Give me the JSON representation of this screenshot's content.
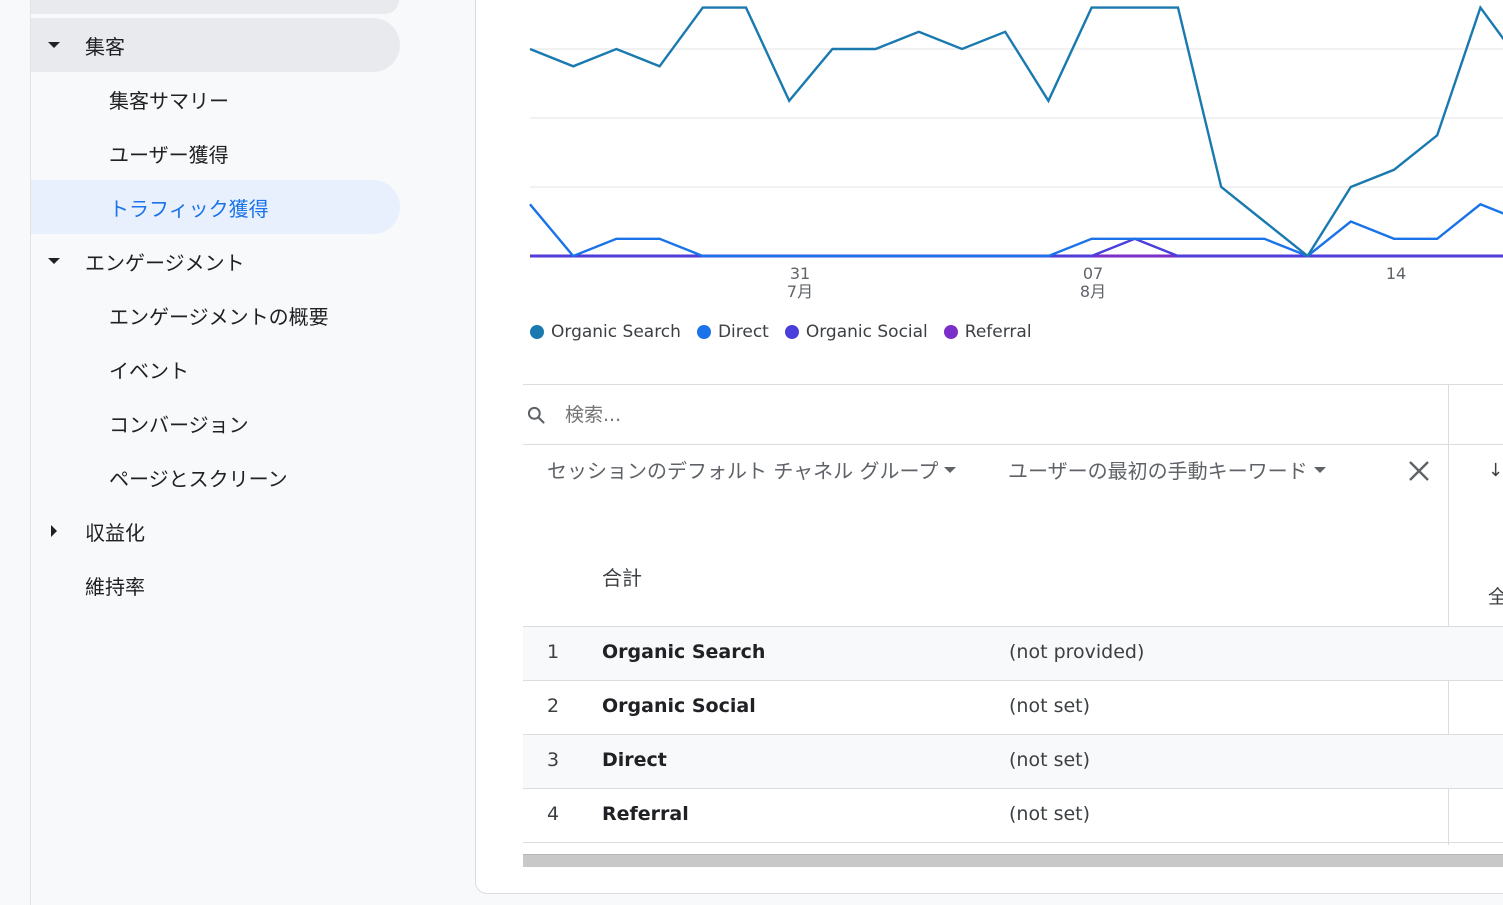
{
  "sidebar": {
    "items": [
      {
        "label": "集客",
        "level": 1,
        "caret": "down",
        "state": "active-group"
      },
      {
        "label": "集客サマリー",
        "level": 2
      },
      {
        "label": "ユーザー獲得",
        "level": 2
      },
      {
        "label": "トラフィック獲得",
        "level": 2,
        "state": "selected"
      },
      {
        "label": "エンゲージメント",
        "level": 1,
        "caret": "down"
      },
      {
        "label": "エンゲージメントの概要",
        "level": 2
      },
      {
        "label": "イベント",
        "level": 2
      },
      {
        "label": "コンバージョン",
        "level": 2
      },
      {
        "label": "ページとスクリーン",
        "level": 2
      },
      {
        "label": "収益化",
        "level": 1,
        "caret": "right"
      },
      {
        "label": "維持率",
        "level": 1
      }
    ]
  },
  "chart_data": {
    "type": "line",
    "x_ticks": [
      {
        "day": "31",
        "month": "7月"
      },
      {
        "day": "07",
        "month": "8月"
      },
      {
        "day": "14",
        "month": ""
      }
    ],
    "series": [
      {
        "name": "Organic Search",
        "color": "#1a7ab0",
        "values": [
          6,
          5.5,
          6,
          5.5,
          7.2,
          7.2,
          4.5,
          6,
          6,
          6.5,
          6,
          6.5,
          4.5,
          7.2,
          7.2,
          7.2,
          2,
          1,
          0,
          2,
          2.5,
          3.5,
          7.2,
          5.5,
          7.2
        ]
      },
      {
        "name": "Direct",
        "color": "#1a73e8",
        "values": [
          1.5,
          0,
          0.5,
          0.5,
          0,
          0,
          0,
          0,
          0,
          0,
          0,
          0,
          0,
          0.5,
          0.5,
          0.5,
          0.5,
          0.5,
          0,
          1,
          0.5,
          0.5,
          1.5,
          1,
          1
        ]
      },
      {
        "name": "Organic Social",
        "color": "#4a3fdb",
        "values": [
          0,
          0,
          0,
          0,
          0,
          0,
          0,
          0,
          0,
          0,
          0,
          0,
          0,
          0,
          0.5,
          0,
          0,
          0,
          0,
          0,
          0,
          0,
          0,
          0,
          0
        ]
      },
      {
        "name": "Referral",
        "color": "#7b2fc9",
        "values": [
          0,
          0,
          0,
          0,
          0,
          0,
          0,
          0,
          0,
          0,
          0,
          0,
          0,
          0,
          0,
          0,
          0,
          0,
          0,
          0,
          0,
          0,
          0,
          0,
          0
        ]
      }
    ],
    "grid": true,
    "legend_position": "bottom-left"
  },
  "table": {
    "search_placeholder": "検索...",
    "dimension1": "セッションのデフォルト チャネル グループ",
    "dimension2": "ユーザーの最初の手動キーワード",
    "sort_glyph": "↓",
    "total_label": "合計",
    "truncated_metric_header": "全",
    "rows": [
      {
        "index": "1",
        "channel": "Organic Search",
        "keyword": "(not provided)"
      },
      {
        "index": "2",
        "channel": "Organic Social",
        "keyword": "(not set)"
      },
      {
        "index": "3",
        "channel": "Direct",
        "keyword": "(not set)"
      },
      {
        "index": "4",
        "channel": "Referral",
        "keyword": "(not set)"
      }
    ]
  }
}
